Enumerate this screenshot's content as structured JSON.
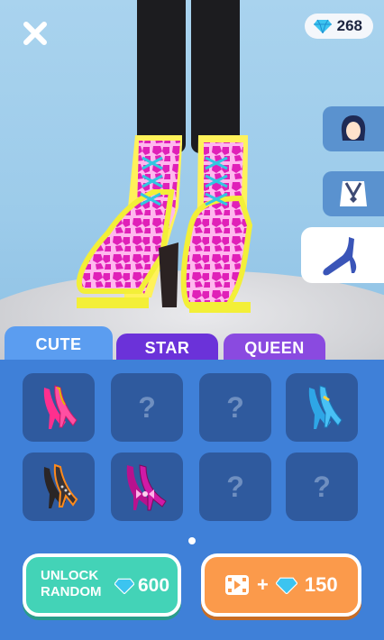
{
  "header": {
    "gems": "268"
  },
  "tabs": [
    {
      "label": "CUTE",
      "active": true
    },
    {
      "label": "STAR",
      "active": false
    },
    {
      "label": "QUEEN",
      "active": false
    }
  ],
  "slots": [
    {
      "state": "owned",
      "item": "pink-heels"
    },
    {
      "state": "locked",
      "label": "?"
    },
    {
      "state": "locked",
      "label": "?"
    },
    {
      "state": "owned",
      "item": "blue-heels"
    },
    {
      "state": "owned",
      "item": "black-spiked-heels"
    },
    {
      "state": "owned",
      "item": "magenta-bow-heels"
    },
    {
      "state": "locked",
      "label": "?"
    },
    {
      "state": "locked",
      "label": "?"
    }
  ],
  "buttons": {
    "unlock_line1": "UNLOCK",
    "unlock_line2": "RANDOM",
    "unlock_cost": "600",
    "ad_prefix": "+",
    "ad_reward": "150"
  },
  "categories": [
    "hair-icon",
    "necklace-icon",
    "shoe-icon"
  ],
  "colors": {
    "panel": "#3f80d8",
    "tab_active": "#5b9df0",
    "tab_star": "#6b32d9",
    "tab_queen": "#8a4ae0",
    "unlock": "#43d3b7",
    "ad": "#fb9a4b"
  }
}
